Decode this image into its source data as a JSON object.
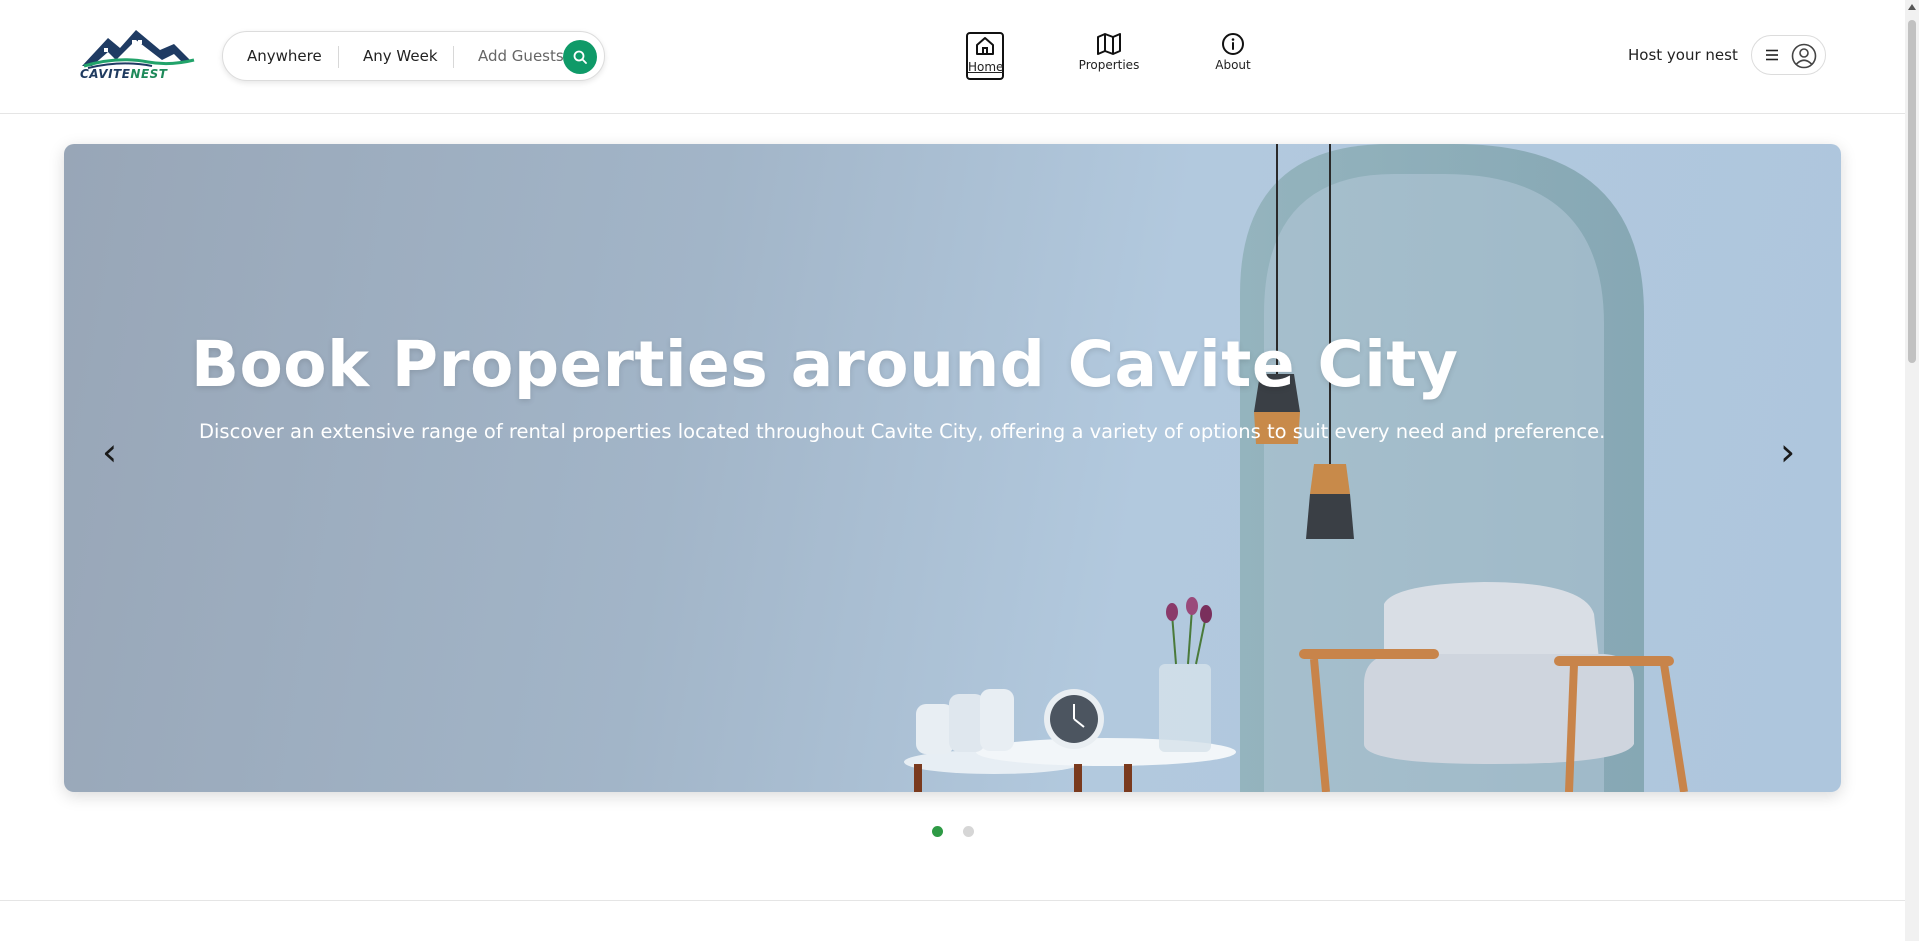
{
  "brand": {
    "logo_part1": "CAVITE",
    "logo_part2": "NEST"
  },
  "search": {
    "location": "Anywhere",
    "dates": "Any Week",
    "guests_placeholder": "Add Guests",
    "search_icon": "search-icon"
  },
  "nav": {
    "tabs": [
      {
        "label": "Home",
        "icon": "home-icon",
        "active": true
      },
      {
        "label": "Properties",
        "icon": "map-icon",
        "active": false
      },
      {
        "label": "About",
        "icon": "info-icon",
        "active": false
      }
    ]
  },
  "account": {
    "host_label": "Host your nest",
    "menu_icon": "hamburger-menu-icon",
    "avatar_icon": "user-avatar-icon"
  },
  "hero": {
    "title": "Book Properties around Cavite City",
    "subtitle": "Discover an extensive range of rental properties located throughout Cavite City, offering a variety of options to suit every need and preference.",
    "prev_label": "‹",
    "next_label": "›",
    "slide_count": 2,
    "active_slide": 1,
    "colors": {
      "active_dot": "#2e9a45",
      "inactive_dot": "#d6d6d6"
    }
  },
  "colors": {
    "accent": "#0f9a68",
    "text": "#222222",
    "hero_overlay": "#a7bbcf"
  }
}
